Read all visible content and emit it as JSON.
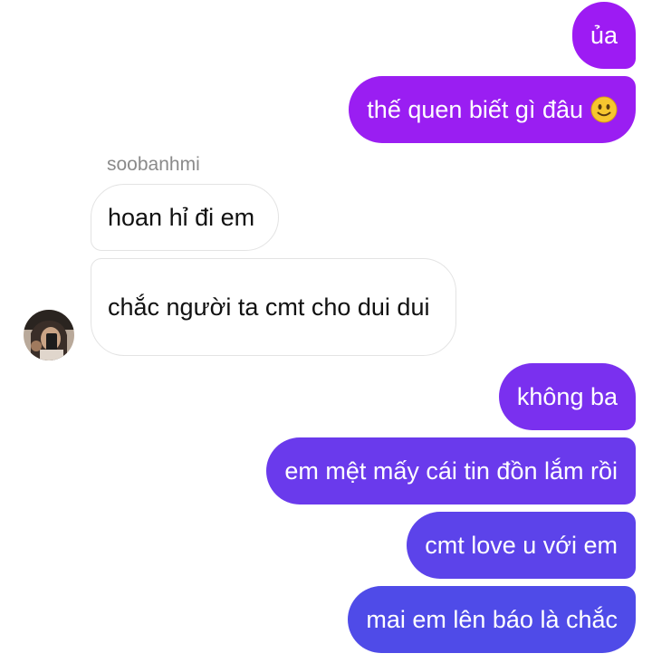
{
  "conversation": {
    "messages": [
      {
        "direction": "outgoing",
        "text": "ủa"
      },
      {
        "direction": "outgoing",
        "text": "thế quen biết gì đâu",
        "emoji": "slightly-smiling-face"
      },
      {
        "direction": "incoming",
        "sender": "soobanhmi",
        "text": "hoan hỉ đi em"
      },
      {
        "direction": "incoming",
        "text": "chắc người ta cmt cho dui dui"
      },
      {
        "direction": "outgoing",
        "text": "không ba"
      },
      {
        "direction": "outgoing",
        "text": "em mệt mấy cái tin đồn lắm rồi"
      },
      {
        "direction": "outgoing",
        "text": "cmt love u với em"
      },
      {
        "direction": "outgoing",
        "text": "mai em lên báo là chắc"
      }
    ]
  },
  "colors": {
    "outgoing_top": "#9b1cf2",
    "outgoing_bottom": "#4d4ee8",
    "incoming_bg": "#ffffff",
    "incoming_border": "#e3e3e3",
    "sender_text": "#8a8a8a"
  }
}
